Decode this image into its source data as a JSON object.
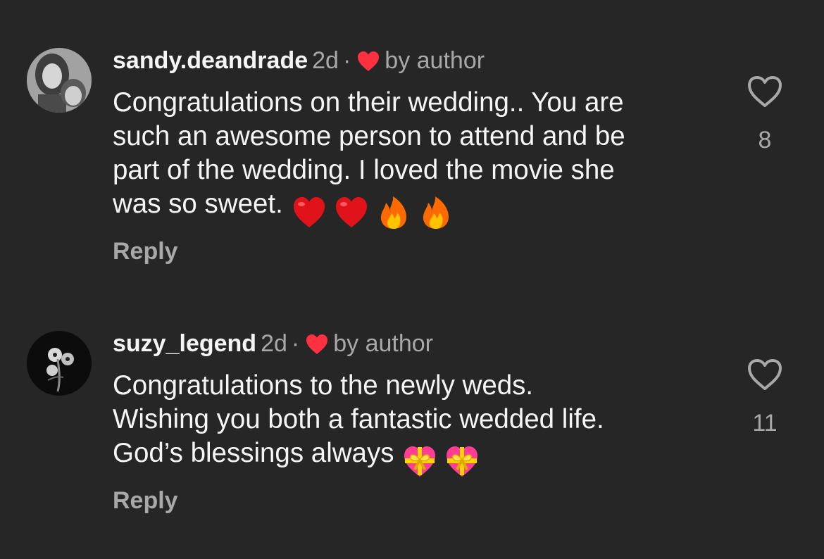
{
  "comments": [
    {
      "username": "sandy.deandrade",
      "time": "2d",
      "separator": "·",
      "liked_by_author_label": "by author",
      "text_lines": [
        "Congratulations on their wedding.. You are",
        "such an awesome person to attend and be",
        "part of the wedding.  I loved the movie she",
        "was so sweet."
      ],
      "emojis": [
        "red-heart-emoji",
        "red-heart-emoji",
        "fire-emoji",
        "fire-emoji"
      ],
      "reply_label": "Reply",
      "like_count": "8"
    },
    {
      "username": "suzy_legend",
      "time": "2d",
      "separator": "·",
      "liked_by_author_label": "by author",
      "text_lines": [
        "Congratulations to the newly weds.",
        "Wishing you both a fantastic wedded life.",
        "God’s blessings always"
      ],
      "emojis": [
        "heart-with-ribbon-emoji",
        "heart-with-ribbon-emoji"
      ],
      "reply_label": "Reply",
      "like_count": "11"
    }
  ],
  "colors": {
    "background": "#262626",
    "primary_text": "#f5f5f5",
    "secondary_text": "#a8a8a8",
    "author_heart": "#ff3040"
  }
}
